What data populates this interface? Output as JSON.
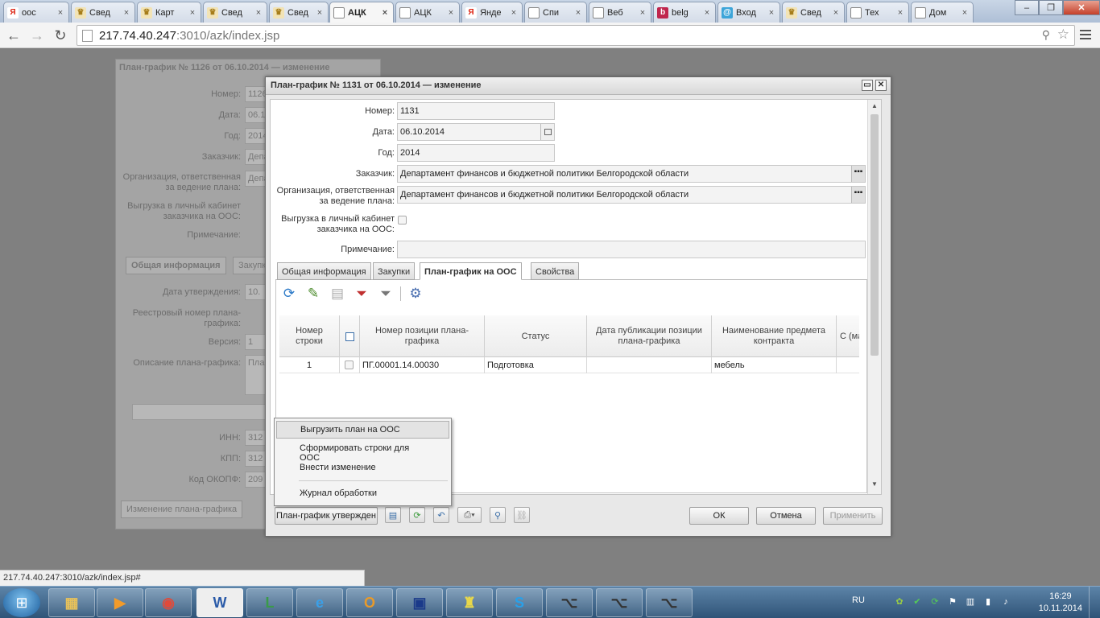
{
  "browser": {
    "tabs": [
      {
        "title": "оос",
        "icon": "yandex-icon"
      },
      {
        "title": "Свед",
        "icon": "eagle-icon"
      },
      {
        "title": "Карт",
        "icon": "eagle-icon"
      },
      {
        "title": "Свед",
        "icon": "eagle-icon"
      },
      {
        "title": "Свед",
        "icon": "eagle-icon"
      },
      {
        "title": "АЦК",
        "icon": "page-icon"
      },
      {
        "title": "АЦК",
        "icon": "page-icon"
      },
      {
        "title": "Янде",
        "icon": "yandex-icon"
      },
      {
        "title": "Спи",
        "icon": "page-icon"
      },
      {
        "title": "Веб",
        "icon": "page-icon"
      },
      {
        "title": "belg",
        "icon": "b-icon"
      },
      {
        "title": "Вход",
        "icon": "mail-icon"
      },
      {
        "title": "Свед",
        "icon": "eagle-icon"
      },
      {
        "title": "Тех",
        "icon": "page-icon"
      },
      {
        "title": "Дом",
        "icon": "page-icon"
      }
    ],
    "url_host": "217.74.40.247",
    "url_path": ":3010/azk/index.jsp",
    "status_url": "217.74.40.247:3010/azk/index.jsp#"
  },
  "bg_dialog": {
    "title": "План-график № 1126 от 06.10.2014 — изменение",
    "fields": [
      {
        "label": "Номер:",
        "value": "1126"
      },
      {
        "label": "Дата:",
        "value": "06.10."
      },
      {
        "label": "Год:",
        "value": "2014"
      },
      {
        "label": "Заказчик:",
        "value": "Депа"
      },
      {
        "label": "Организация, ответственная за ведение плана:",
        "value": "Депа"
      },
      {
        "label": "Выгрузка в личный кабинет заказчика на ООС:",
        "value": ""
      },
      {
        "label": "Примечание:",
        "value": ""
      }
    ],
    "tabs": [
      "Общая информация",
      "Закупк"
    ],
    "fields2": [
      {
        "label": "Дата утверждения:",
        "value": "10."
      },
      {
        "label": "Реестровый номер плана-графика:",
        "value": ""
      },
      {
        "label": "Версия:",
        "value": "1"
      },
      {
        "label": "Описание плана-графика:",
        "value": "Пла"
      },
      {
        "label": "ИНН:",
        "value": "312"
      },
      {
        "label": "КПП:",
        "value": "312"
      },
      {
        "label": "Код ОКОПФ:",
        "value": "209"
      }
    ],
    "button": "Изменение плана-графика"
  },
  "dialog": {
    "title": "План-график № 1131 от 06.10.2014 — изменение",
    "number_label": "Номер:",
    "number_value": "1131",
    "date_label": "Дата:",
    "date_value": "06.10.2014",
    "year_label": "Год:",
    "year_value": "2014",
    "customer_label": "Заказчик:",
    "customer_value": "Департамент финансов и бюджетной политики Белгородской области",
    "org_label": "Организация, ответственная за ведение плана:",
    "org_value": "Департамент финансов и бюджетной политики Белгородской области",
    "export_label": "Выгрузка в личный кабинет заказчика на ООС:",
    "note_label": "Примечание:",
    "note_value": "",
    "tabs": [
      "Общая информация",
      "Закупки",
      "План-график на ООС",
      "Свойства"
    ],
    "grid_headers": [
      "Номер строки",
      "",
      "Номер позиции плана-графика",
      "Статус",
      "Дата публикации позиции плана-графика",
      "Наименование предмета контракта",
      "С (ма"
    ],
    "grid_rows": [
      {
        "num": "1",
        "position": "ПГ.00001.14.00030",
        "status": "Подготовка",
        "date": "",
        "subject": "мебель"
      }
    ],
    "status_button": "План-график утвержден",
    "ok": "ОК",
    "cancel": "Отмена",
    "apply": "Применить"
  },
  "context_menu": {
    "items": [
      "Выгрузить план на ООС",
      "Сформировать строки для ООС",
      "Внести изменение",
      "Журнал обработки"
    ]
  },
  "taskbar": {
    "lang": "RU",
    "time": "16:29",
    "date": "10.11.2014"
  }
}
